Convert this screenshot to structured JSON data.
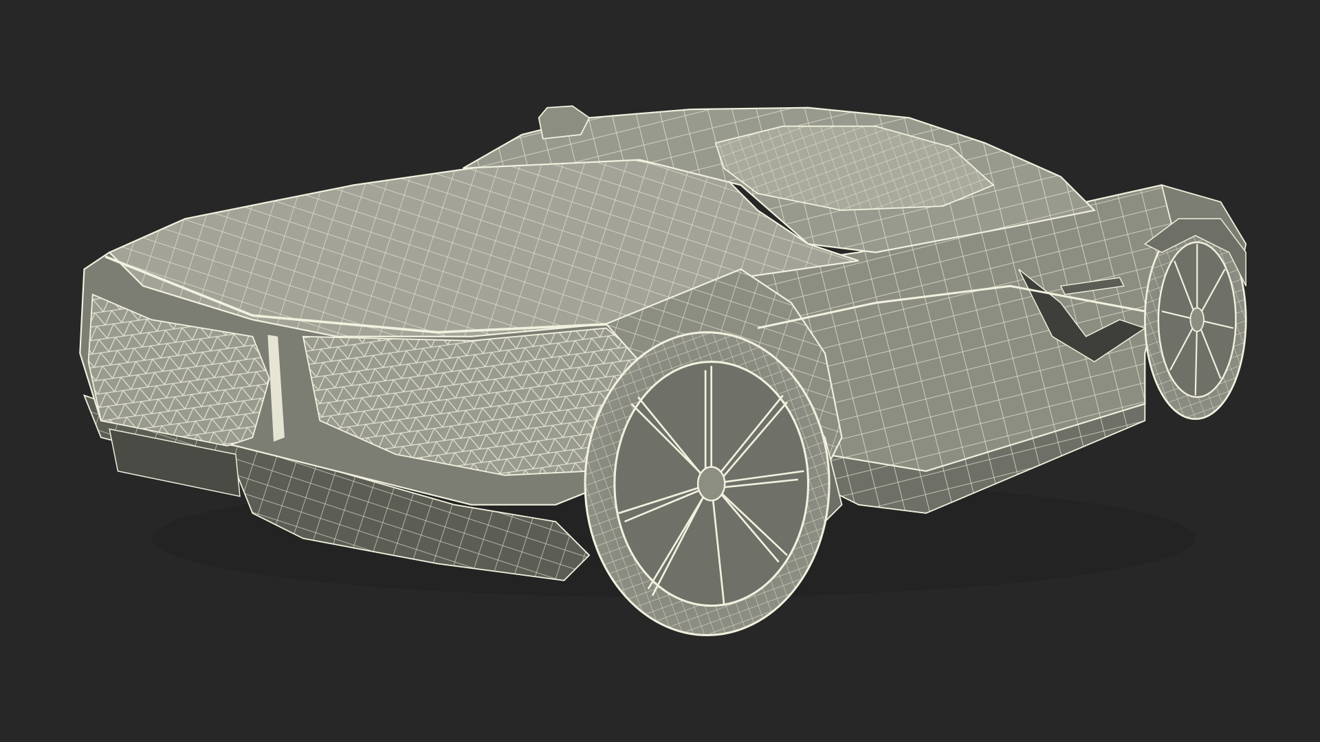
{
  "scene": {
    "background_color": "#272727",
    "subject": "wireframe-sports-car",
    "view": "rear-three-quarter",
    "colors": {
      "surface": "#8d8e82",
      "surface_light": "#a3a497",
      "surface_dark": "#5c5d55",
      "shadow": "#3e3f3a",
      "wire": "#f2f1df",
      "glass": "#a9aa9c"
    }
  }
}
